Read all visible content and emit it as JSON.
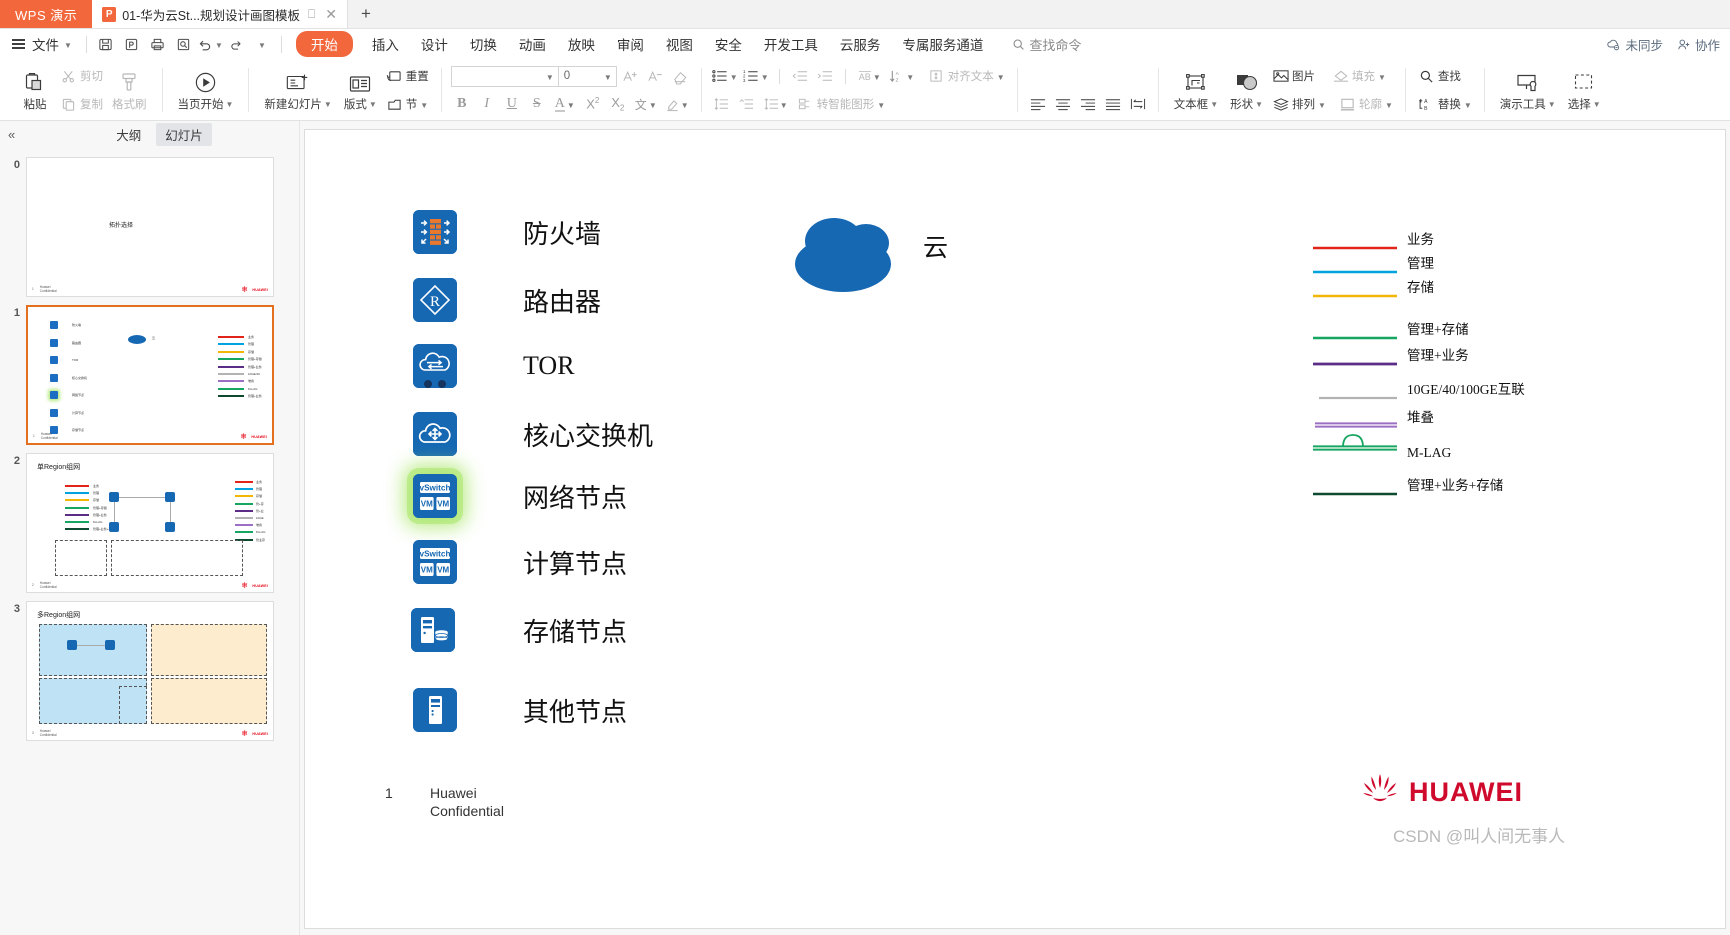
{
  "titlebar": {
    "app_name": "WPS 演示",
    "tab_title": "01-华为云St...规划设计画图模板",
    "tab_icon": "ppt-file-icon",
    "restore_icon": "restore-tab-icon",
    "close_icon": "close-tab-icon",
    "new_tab_icon": "+"
  },
  "menubar": {
    "file_label": "文件",
    "quick_access": [
      "save-icon",
      "export-pdf-icon",
      "print-icon",
      "print-preview-icon",
      "undo-icon",
      "redo-icon",
      "customize-icon"
    ],
    "home_tab": "开始",
    "tabs": [
      "插入",
      "设计",
      "切换",
      "动画",
      "放映",
      "审阅",
      "视图",
      "安全",
      "开发工具",
      "云服务",
      "专属服务通道"
    ],
    "search_placeholder": "查找命令",
    "sync_status": "未同步",
    "collab_label": "协作"
  },
  "ribbon": {
    "clipboard": {
      "paste": "粘贴",
      "cut": "剪切",
      "copy": "复制",
      "format_painter": "格式刷"
    },
    "present": {
      "from_current": "当页开始"
    },
    "slides": {
      "new_slide": "新建幻灯片",
      "layout": "版式",
      "reset": "重置",
      "section": "节"
    },
    "font": {
      "font_name": "",
      "font_name_placeholder": "",
      "font_size": "0",
      "grow_font": "A+",
      "shrink_font": "A-",
      "clear_format": "clear-format-icon",
      "bold": "B",
      "italic": "I",
      "underline": "U",
      "strikethrough": "S",
      "font_color": "A",
      "superscript": "X²",
      "subscript": "X₂",
      "char_style": "文",
      "highlight": "highlight-icon"
    },
    "paragraph": {
      "bullets": "bullets-icon",
      "numbering": "numbering-icon",
      "decrease_indent": "decrease-indent-icon",
      "increase_indent": "increase-indent-icon",
      "text_direction": "AB",
      "sort": "sort-icon",
      "align_text": "对齐文本",
      "line_spacing": "line-spacing-icon",
      "convert_smartart": "转智能图形",
      "align_left": "align-left-icon",
      "align_center": "align-center-icon",
      "align_right": "align-right-icon",
      "align_justify": "align-justify-icon",
      "columns": "columns-icon"
    },
    "insert": {
      "textbox": "文本框",
      "shape": "形状",
      "picture": "图片",
      "arrange": "排列",
      "fill": "填充",
      "outline": "轮廓"
    },
    "editing": {
      "find": "查找",
      "replace": "替换"
    },
    "tools": {
      "present_tools": "演示工具",
      "select": "选择"
    }
  },
  "slide_panel": {
    "collapse_icon": "collapse-panel-icon",
    "tabs": [
      {
        "label": "大纲",
        "active": false
      },
      {
        "label": "幻灯片",
        "active": true
      }
    ],
    "slides": [
      {
        "index": "0",
        "title": "拓扑选择",
        "selected": false
      },
      {
        "index": "1",
        "title": "",
        "selected": true
      },
      {
        "index": "2",
        "title": "单Region组网",
        "selected": false
      },
      {
        "index": "3",
        "title": "多Region组网",
        "selected": false
      }
    ],
    "thumb_footer_number": "1",
    "thumb_footer_text": "Huawei Confidential",
    "thumb_brand": "HUAWEI"
  },
  "slide": {
    "nodes": [
      {
        "label": "防火墙",
        "icon": "firewall-icon",
        "highlighted": false
      },
      {
        "label": "路由器",
        "icon": "router-icon",
        "highlighted": false
      },
      {
        "label": "TOR",
        "icon": "tor-switch-icon",
        "highlighted": false
      },
      {
        "label": "核心交换机",
        "icon": "core-switch-icon",
        "highlighted": false
      },
      {
        "label": "网络节点",
        "icon": "network-node-icon",
        "highlighted": true
      },
      {
        "label": "计算节点",
        "icon": "compute-node-icon",
        "highlighted": false
      },
      {
        "label": "存储节点",
        "icon": "storage-node-icon",
        "highlighted": false
      },
      {
        "label": "其他节点",
        "icon": "other-node-icon",
        "highlighted": false
      }
    ],
    "cloud": {
      "label": "云",
      "color": "#1668b3"
    },
    "legend": [
      {
        "label": "业务",
        "color": "#e2231a",
        "style": "solid"
      },
      {
        "label": "管理",
        "color": "#00a3e0",
        "style": "solid"
      },
      {
        "label": "存储",
        "color": "#f2b705",
        "style": "solid"
      },
      {
        "label": "管理+存储",
        "color": "#17a562",
        "style": "solid"
      },
      {
        "label": "管理+业务",
        "color": "#5b2d87",
        "style": "solid"
      },
      {
        "label": "10GE/40/100GE互联",
        "color": "#b3b3b3",
        "style": "solid"
      },
      {
        "label": "堆叠",
        "color": "#9b6fc4",
        "style": "double"
      },
      {
        "label": "M-LAG",
        "color": "#17a562",
        "style": "mlag"
      },
      {
        "label": "管理+业务+存储",
        "color": "#0d4a2f",
        "style": "solid"
      }
    ],
    "footer": {
      "page_number": "1",
      "confidential_line1": "Huawei",
      "confidential_line2": "Confidential",
      "brand_flower": "huawei-flower-icon",
      "brand_word": "HUAWEI"
    },
    "watermark": "CSDN @叫人间无事人"
  },
  "colors": {
    "wps_orange": "#f2683c",
    "huawei_blue": "#1668b3",
    "huawei_red": "#cf0a2c",
    "selection_green": "#a8e668"
  }
}
